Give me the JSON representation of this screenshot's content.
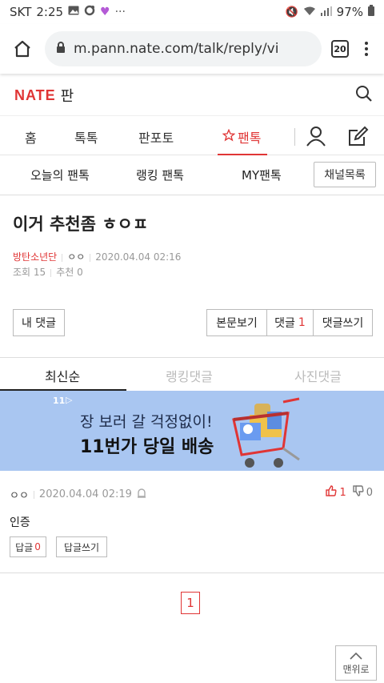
{
  "status": {
    "carrier": "SKT",
    "time": "2:25",
    "battery": "97%"
  },
  "browser": {
    "url": "m.pann.nate.com/talk/reply/vi",
    "tab_count": "20"
  },
  "site": {
    "logo": "NATE",
    "logo_sub": "판"
  },
  "main_nav": [
    "홈",
    "톡톡",
    "판포토",
    "팬톡"
  ],
  "sub_nav": {
    "items": [
      "오늘의 팬톡",
      "랭킹 팬톡",
      "MY팬톡"
    ],
    "channel_button": "채널목록"
  },
  "post": {
    "title": "이거 추천좀 ㅎㅇㅍ",
    "author": "방탄소년단",
    "nick": "ㅇㅇ",
    "date": "2020.04.04 02:16",
    "views_label": "조회",
    "views": "15",
    "recommend_label": "추천",
    "recommend": "0"
  },
  "actions": {
    "my_comments": "내 댓글",
    "view_body": "본문보기",
    "comments_label": "댓글",
    "comments_count": "1",
    "write_comment": "댓글쓰기"
  },
  "comment_tabs": [
    "최신순",
    "랭킹댓글",
    "사진댓글"
  ],
  "banner": {
    "brand": "11",
    "line1": "장 보러 갈 걱정없이!",
    "line2": "11번가 당일 배송"
  },
  "comment": {
    "nick": "ㅇㅇ",
    "date": "2020.04.04 02:19",
    "up": "1",
    "down": "0",
    "body": "인증",
    "reply_label": "답글",
    "reply_count": "0",
    "write_reply": "답글쓰기"
  },
  "pagination": {
    "current": "1"
  },
  "to_top": "맨위로",
  "colors": {
    "accent": "#e03535",
    "banner_bg": "#a9c6f1"
  }
}
